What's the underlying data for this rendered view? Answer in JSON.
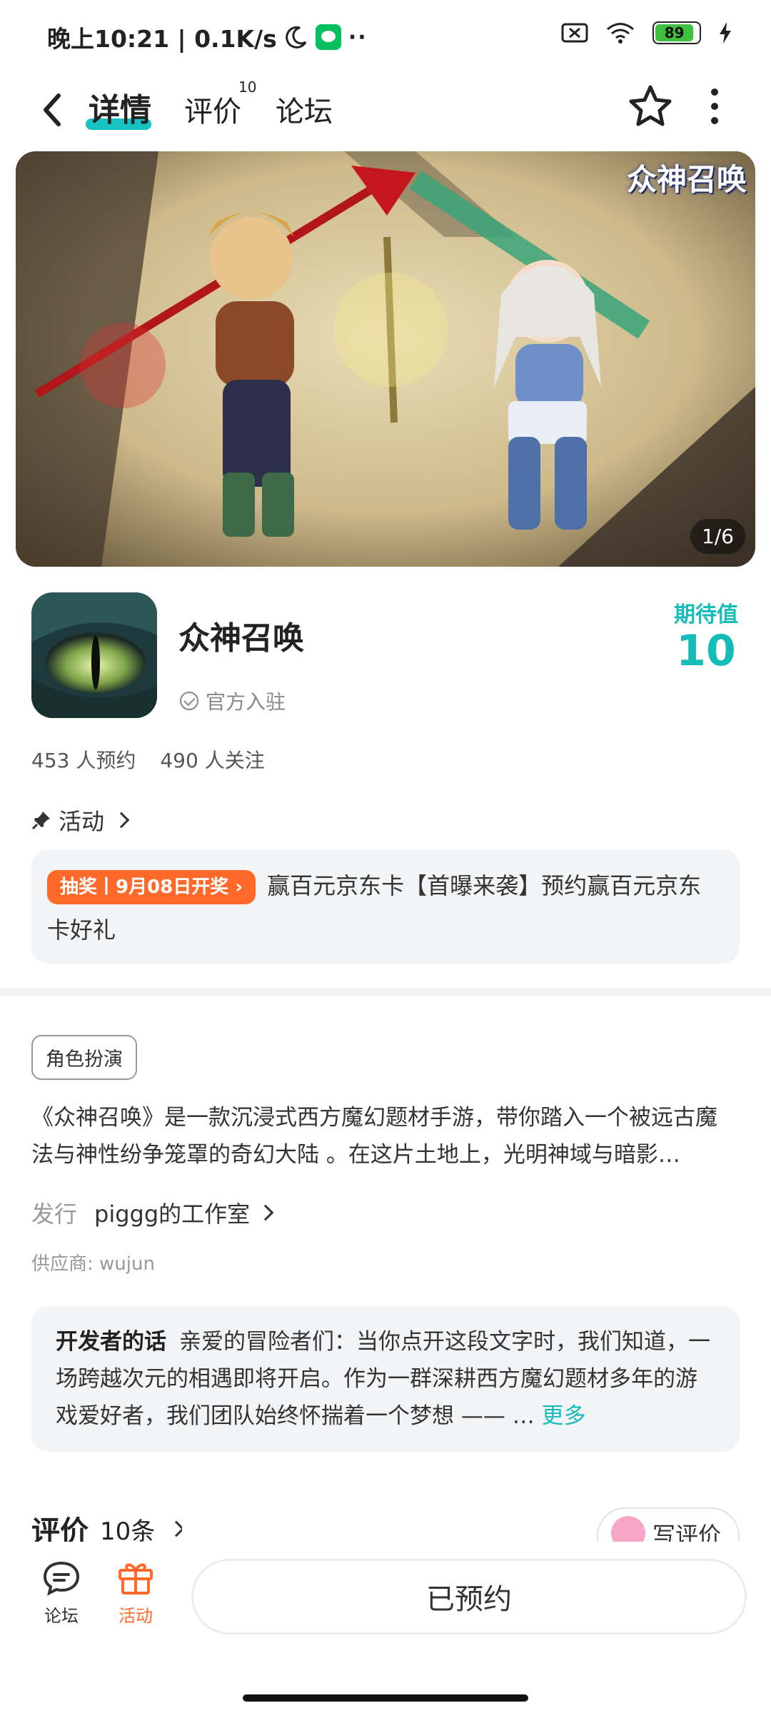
{
  "status_bar": {
    "time_speed": "晚上10:21 | 0.1K/s",
    "more": "··",
    "battery": "89"
  },
  "nav": {
    "tabs": [
      {
        "label": "详情",
        "active": true
      },
      {
        "label": "评价",
        "badge": "10"
      },
      {
        "label": "论坛"
      }
    ]
  },
  "banner": {
    "logo_text": "众神召唤",
    "page_indicator": "1/6"
  },
  "app": {
    "title": "众神召唤",
    "verified_label": "官方入驻",
    "expect_label": "期待值",
    "expect_value": "10",
    "reservations": "453 人预约",
    "followers": "490 人关注"
  },
  "activity": {
    "header": "活动",
    "badge": "抽奖丨9月08日开奖",
    "text": "赢百元京东卡【首曝来袭】预约赢百元京东卡好礼"
  },
  "details": {
    "genre_tag": "角色扮演",
    "description": "《众神召唤》是一款沉浸式西方魔幻题材手游，带你踏入一个被远古魔法与神性纷争笼罩的奇幻大陆 。在这片土地上，光明神域与暗影…",
    "publisher_key": "发行",
    "publisher_value": "piggg的工作室",
    "supplier": "供应商: wujun"
  },
  "developer_note": {
    "key": "开发者的话",
    "text": "亲爱的冒险者们：当你点开这段文字时，我们知道，一场跨越次元的相遇即将开启。作为一群深耕西方魔幻题材多年的游戏爱好者，我们团队始终怀揣着一个梦想 —— …",
    "more": "更多"
  },
  "reviews": {
    "title": "评价",
    "count": "10条",
    "write_label": "写评价"
  },
  "bottom_bar": {
    "forum_label": "论坛",
    "activity_label": "活动",
    "reserve_button": "已预约"
  },
  "colors": {
    "accent": "#16c2c2",
    "orange": "#ff6a2b"
  }
}
